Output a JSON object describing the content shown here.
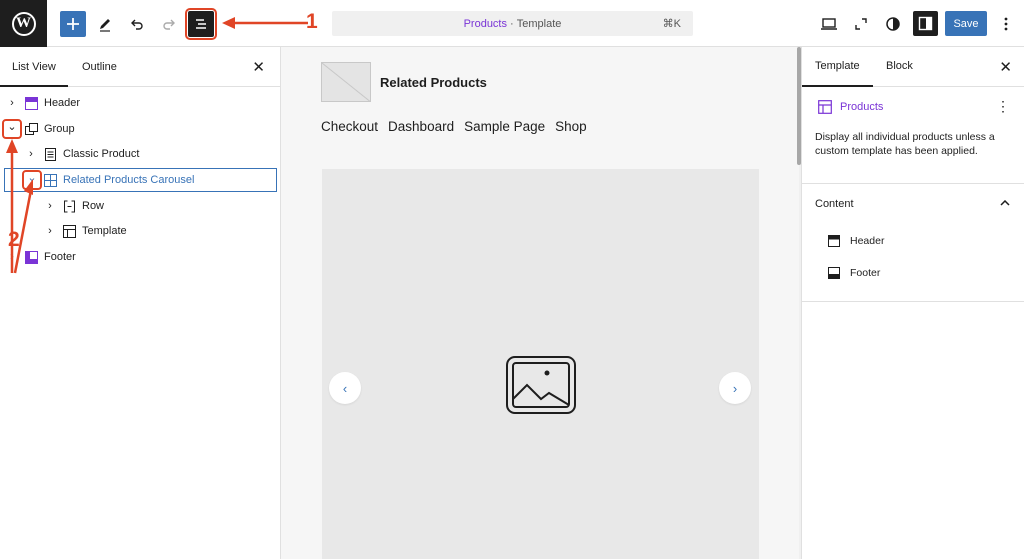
{
  "header": {
    "logo_letter": "W",
    "add_icon": "plus-icon",
    "command": {
      "title": "Products",
      "separator": " · ",
      "subtitle": "Template",
      "shortcut": "⌘K"
    },
    "save_label": "Save"
  },
  "annotations": {
    "one": "1",
    "two": "2",
    "color": "#e04526"
  },
  "list_panel": {
    "tabs": [
      "List View",
      "Outline"
    ],
    "close": "✕",
    "items": [
      {
        "label": "Header",
        "icon": "header-layout-icon",
        "chevron": "›"
      },
      {
        "label": "Group",
        "icon": "group-icon",
        "chevron": "⌄"
      },
      {
        "label": "Classic Product",
        "icon": "document-icon",
        "chevron": "›"
      },
      {
        "label": "Related Products Carousel",
        "icon": "grid-icon",
        "chevron": "⌄"
      },
      {
        "label": "Row",
        "icon": "row-icon",
        "chevron": "›"
      },
      {
        "label": "Template",
        "icon": "template-icon",
        "chevron": "›"
      },
      {
        "label": "Footer",
        "icon": "footer-layout-icon",
        "chevron": "›"
      }
    ]
  },
  "canvas": {
    "site_title": "Related Products",
    "nav": [
      "Checkout",
      "Dashboard",
      "Sample Page",
      "Shop"
    ],
    "prev": "‹",
    "next": "›"
  },
  "settings_panel": {
    "tabs": [
      "Template",
      "Block"
    ],
    "close": "✕",
    "template_name": "Products",
    "more": "⋮",
    "description": "Display all individual products unless a custom template has been applied.",
    "content_heading": "Content",
    "content_items": [
      "Header",
      "Footer"
    ],
    "accent": "#7a34d6"
  }
}
